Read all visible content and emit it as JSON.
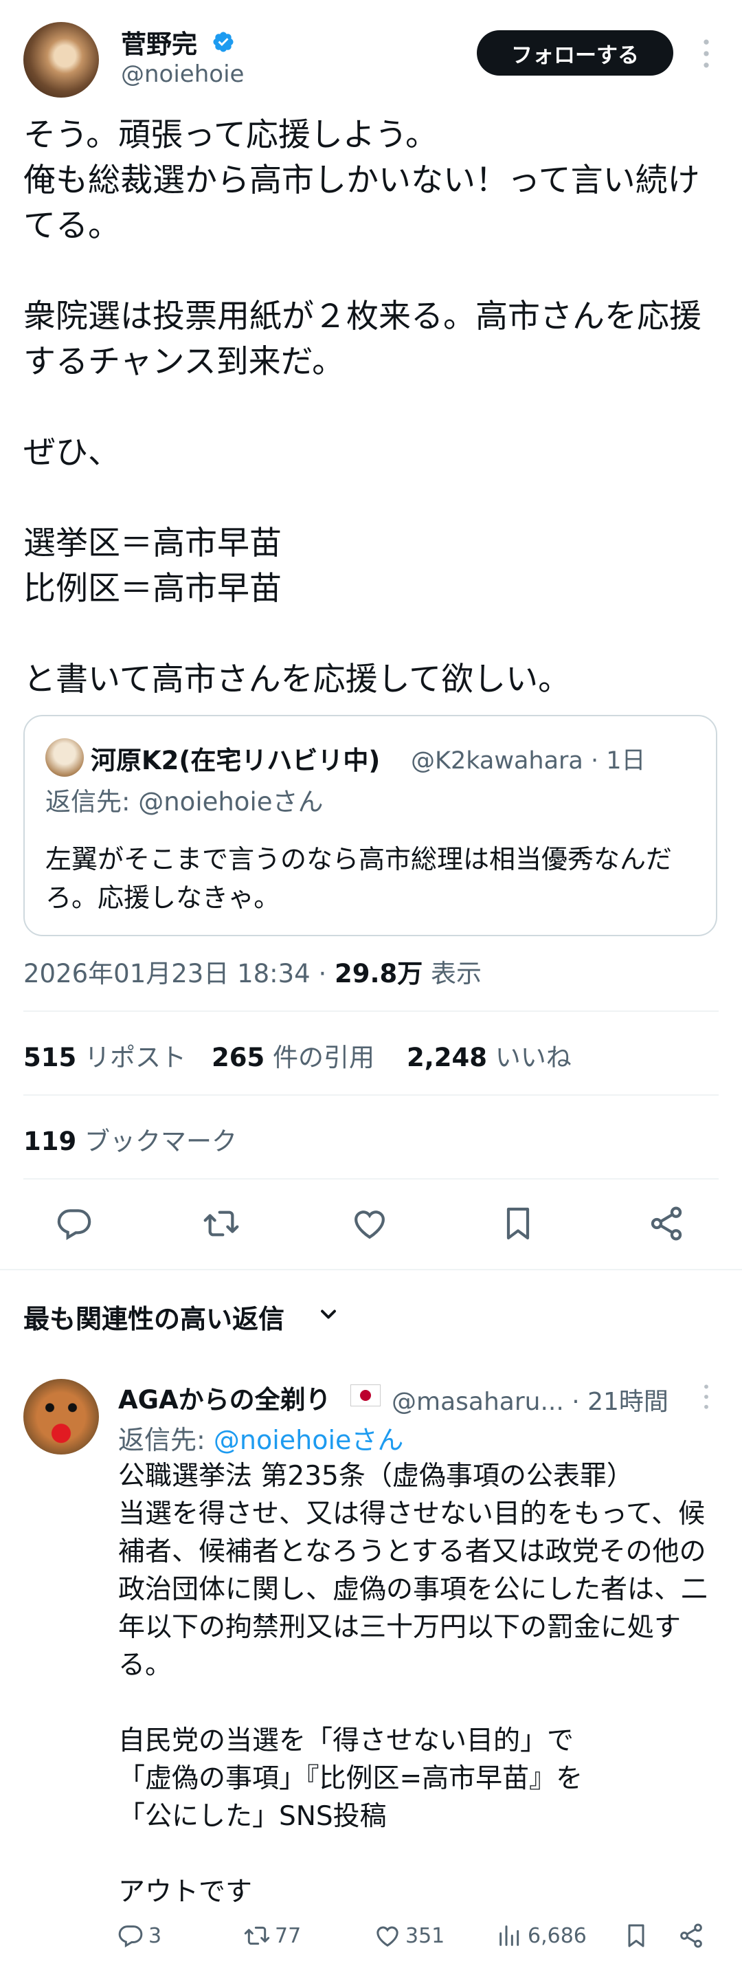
{
  "tweet": {
    "author": {
      "display_name": "菅野完",
      "handle": "@noiehoie",
      "verified": true
    },
    "follow_label": "フォローする",
    "text": "そう。頑張って応援しよう。\n俺も総裁選から高市しかいない！って言い続けてる。\n\n衆院選は投票用紙が２枚来る。高市さんを応援するチャンス到来だ。\n\nぜひ、\n\n選挙区＝高市早苗\n比例区＝高市早苗\n\nと書いて高市さんを応援して欲しい。",
    "quoted": {
      "display_name": "河原K2(在宅リハビリ中)",
      "handle_time": "@K2kawahara · 1日",
      "reply_to": "返信先: @noiehoieさん",
      "text": "左翼がそこまで言うのなら高市総理は相当優秀なんだろ。応援しなきゃ。"
    },
    "timestamp": "2026年01月23日 18:34 · ",
    "views_count": "29.8万",
    "views_label": " 表示",
    "stats": {
      "reposts_count": "515",
      "reposts_label": " リポスト",
      "quotes_count": "265",
      "quotes_label": " 件の引用",
      "likes_count": "2,248",
      "likes_label": " いいね",
      "bookmarks_count": "119",
      "bookmarks_label": " ブックマーク"
    }
  },
  "replies_header": "最も関連性の高い返信",
  "reply": {
    "display_name": "AGAからの全剃り",
    "handle_time": "@masaharu... · 21時間",
    "reply_to_prefix": "返信先: ",
    "reply_to_handle": "@noiehoieさん",
    "text": "公職選挙法 第235条（虚偽事項の公表罪）\n当選を得させ、又は得させない目的をもって、候補者、候補者となろうとする者又は政党その他の政治団体に関し、虚偽の事項を公にした者は、二年以下の拘禁刑又は三十万円以下の罰金に処する。\n\n自民党の当選を「得させない目的」で\n「虚偽の事項」『比例区=高市早苗』を\n「公にした」SNS投稿\n\nアウトです",
    "actions": {
      "replies": "3",
      "reposts": "77",
      "likes": "351",
      "views": "6,686"
    }
  },
  "colors": {
    "text": "#0f1419",
    "muted": "#536471",
    "accent": "#1d9bf0",
    "border": "#cfd9de"
  },
  "icons": [
    "verified-badge-icon",
    "more-icon",
    "reply-icon",
    "repost-icon",
    "like-icon",
    "bookmark-icon",
    "share-icon",
    "chevron-down-icon",
    "views-icon",
    "japan-flag-icon"
  ]
}
